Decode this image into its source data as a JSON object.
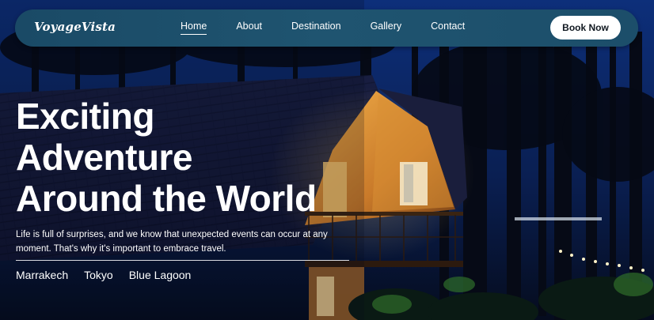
{
  "brand": {
    "logo": "VoyageVista"
  },
  "nav": {
    "links": [
      {
        "label": "Home",
        "active": true
      },
      {
        "label": "About",
        "active": false
      },
      {
        "label": "Destination",
        "active": false
      },
      {
        "label": "Gallery",
        "active": false
      },
      {
        "label": "Contact",
        "active": false
      }
    ],
    "cta_label": "Book Now"
  },
  "hero": {
    "headline_lines": [
      "Exciting",
      "Adventure",
      "Around the World"
    ],
    "tagline": "Life is full of surprises, and we know that unexpected events can occur at any moment. That's why it's important to embrace travel.",
    "destinations": [
      "Marrakech",
      "Tokyo",
      "Blue Lagoon"
    ]
  },
  "colors": {
    "nav_bg": "#1f5470",
    "night_sky": "#0b2a6b",
    "cabin_glow": "#e8a640",
    "button_bg": "#ffffff",
    "text": "#ffffff"
  }
}
